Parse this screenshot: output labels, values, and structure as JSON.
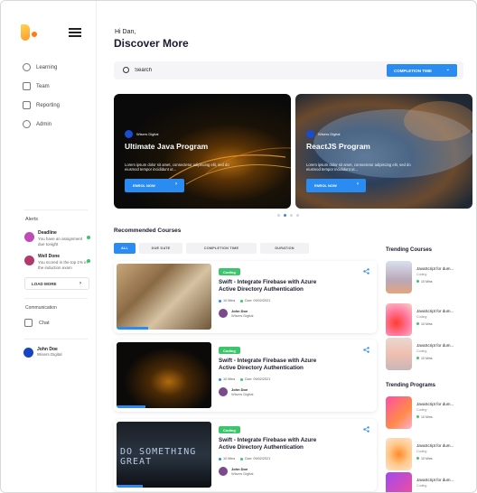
{
  "sidebar": {
    "nav": [
      {
        "label": "Learning"
      },
      {
        "label": "Team"
      },
      {
        "label": "Reporting"
      },
      {
        "label": "Admin"
      }
    ],
    "alerts_title": "Alerts",
    "alerts": [
      {
        "title": "Deadline",
        "text": "You have an assignment due tonight",
        "color": "#c04ab8"
      },
      {
        "title": "Well Done",
        "text": "You scored in the top 1% in the induction exam",
        "color": "#b23a6a"
      }
    ],
    "load_more": "LOAD MORE",
    "communication_title": "Communication",
    "chat_label": "Chat",
    "user": {
      "name": "John Doe",
      "org": "Wisers Digital"
    }
  },
  "header": {
    "greeting": "Hi Dan,",
    "title": "Discover More"
  },
  "search": {
    "placeholder": "Search",
    "filter_label": "COMPLETION TIME"
  },
  "banners": [
    {
      "publisher": "Wisers Digital",
      "title": "Ultimate Java Program",
      "desc": "Lorem ipsum dolor sit amet, consectetur adipiscing elit, sed do eiusmod tempor incididunt ut...",
      "cta": "ENROL NOW"
    },
    {
      "publisher": "Wisers Digital",
      "title": "ReactJS Program",
      "desc": "Lorem ipsum dolor sit amet, consectetur adipiscing elit, sed do eiusmod tempor incididunt ut...",
      "cta": "ENROL NOW"
    }
  ],
  "recommended": {
    "title": "Recommended Courses",
    "filters": [
      "ALL",
      "DUE DATE",
      "COMPLETION TIME",
      "DURATION"
    ],
    "courses": [
      {
        "tag": "Coding",
        "title": "Swift - Integrate Firebase with Azure Active Directory Authentication",
        "duration": "10 Mins",
        "due": "Due: 09/02/2021",
        "author": "John Doe",
        "org": "Wisers Digital",
        "progress": 0.33
      },
      {
        "tag": "Coding",
        "title": "Swift - Integrate Firebase with Azure Active Directory Authentication",
        "duration": "10 Mins",
        "due": "Due: 09/02/2021",
        "author": "John Doe",
        "org": "Wisers Digital",
        "progress": 0.3
      },
      {
        "tag": "Coding",
        "title": "Swift - Integrate Firebase with Azure Active Directory Authentication",
        "duration": "10 Mins",
        "due": "Due: 09/02/2021",
        "author": "John Doe",
        "org": "Wisers Digital",
        "progress": 0.28
      }
    ]
  },
  "trending_courses": {
    "title": "Trending Courses",
    "items": [
      {
        "title": "JavaScript for dum...",
        "category": "Coding",
        "duration": "10 Mins"
      },
      {
        "title": "JavaScript for dum...",
        "category": "Coding",
        "duration": "10 Mins"
      },
      {
        "title": "JavaScript for dum...",
        "category": "Coding",
        "duration": "10 Mins"
      }
    ]
  },
  "trending_programs": {
    "title": "Trending Programs",
    "items": [
      {
        "title": "JavaScript for dum...",
        "category": "Coding",
        "duration": "10 Mins"
      },
      {
        "title": "JavaScript for dum...",
        "category": "Coding",
        "duration": "10 Mins"
      },
      {
        "title": "JavaScript for dum...",
        "category": "Coding"
      }
    ]
  },
  "colors": {
    "accent": "#2a8cf0",
    "tag": "#3cc56b"
  }
}
